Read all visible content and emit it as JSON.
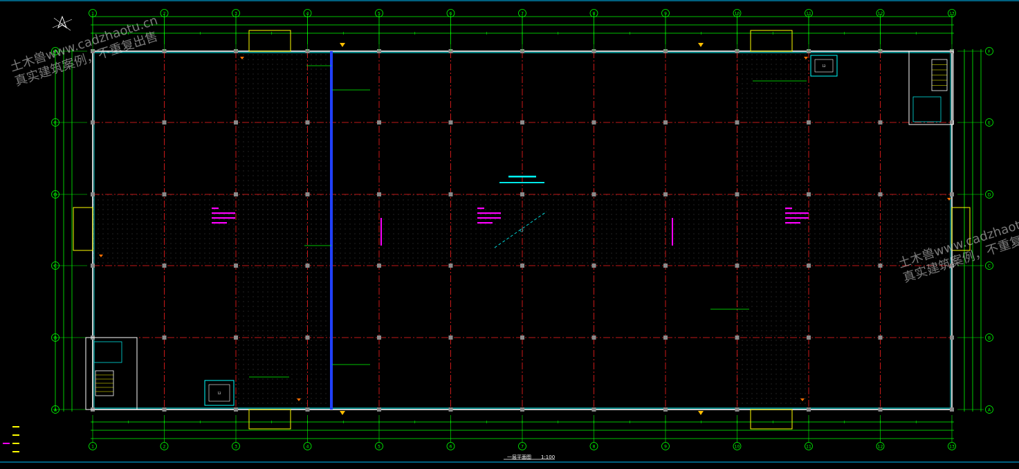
{
  "drawing": {
    "title": "一层平面图",
    "scale": "1:100",
    "watermark_line1": "土木兽www.cadzhaotu.cn",
    "watermark_line2": "真实建筑案例，不重复出售",
    "column_axes": [
      "1",
      "2",
      "3",
      "4",
      "5",
      "6",
      "7",
      "8",
      "9",
      "10",
      "11",
      "12",
      "13"
    ],
    "row_axes": [
      "A",
      "B",
      "C",
      "D",
      "E",
      "F"
    ],
    "room_labels": [
      "12",
      "12",
      "12"
    ],
    "colors": {
      "background": "#000000",
      "axis_line": "#ff2020",
      "wall": "#ffffff",
      "window": "#00ffff",
      "dimension": "#00ff00",
      "annotation": "#ff00ff",
      "stair": "#ffff00",
      "section": "#2040ff",
      "column": "#8a8a8a"
    }
  }
}
